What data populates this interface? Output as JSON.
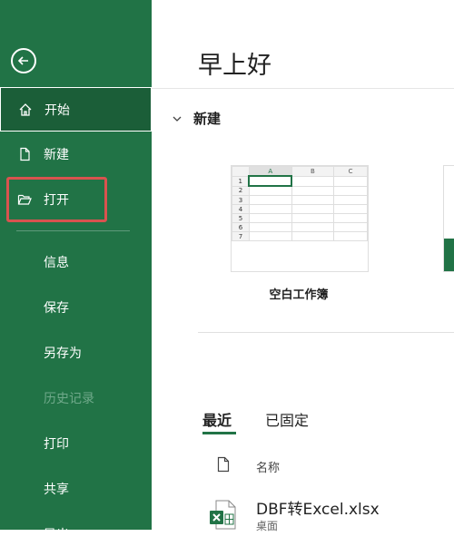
{
  "sidebar": {
    "items": [
      {
        "label": "开始"
      },
      {
        "label": "新建"
      },
      {
        "label": "打开"
      },
      {
        "label": "信息"
      },
      {
        "label": "保存"
      },
      {
        "label": "另存为"
      },
      {
        "label": "历史记录"
      },
      {
        "label": "打印"
      },
      {
        "label": "共享"
      },
      {
        "label": "导出"
      }
    ]
  },
  "main": {
    "greeting": "早上好",
    "new_section": {
      "title": "新建",
      "template_label": "空白工作簿",
      "grid": {
        "columns": [
          "A",
          "B",
          "C"
        ],
        "rows": [
          "1",
          "2",
          "3",
          "4",
          "5",
          "6",
          "7"
        ]
      }
    },
    "tabs": [
      {
        "label": "最近"
      },
      {
        "label": "已固定"
      }
    ],
    "file_list": {
      "name_header": "名称",
      "files": [
        {
          "name": "DBF转Excel.xlsx",
          "location": "桌面"
        }
      ]
    }
  },
  "colors": {
    "brand_green": "#217346",
    "highlight_red": "#d9534f"
  }
}
